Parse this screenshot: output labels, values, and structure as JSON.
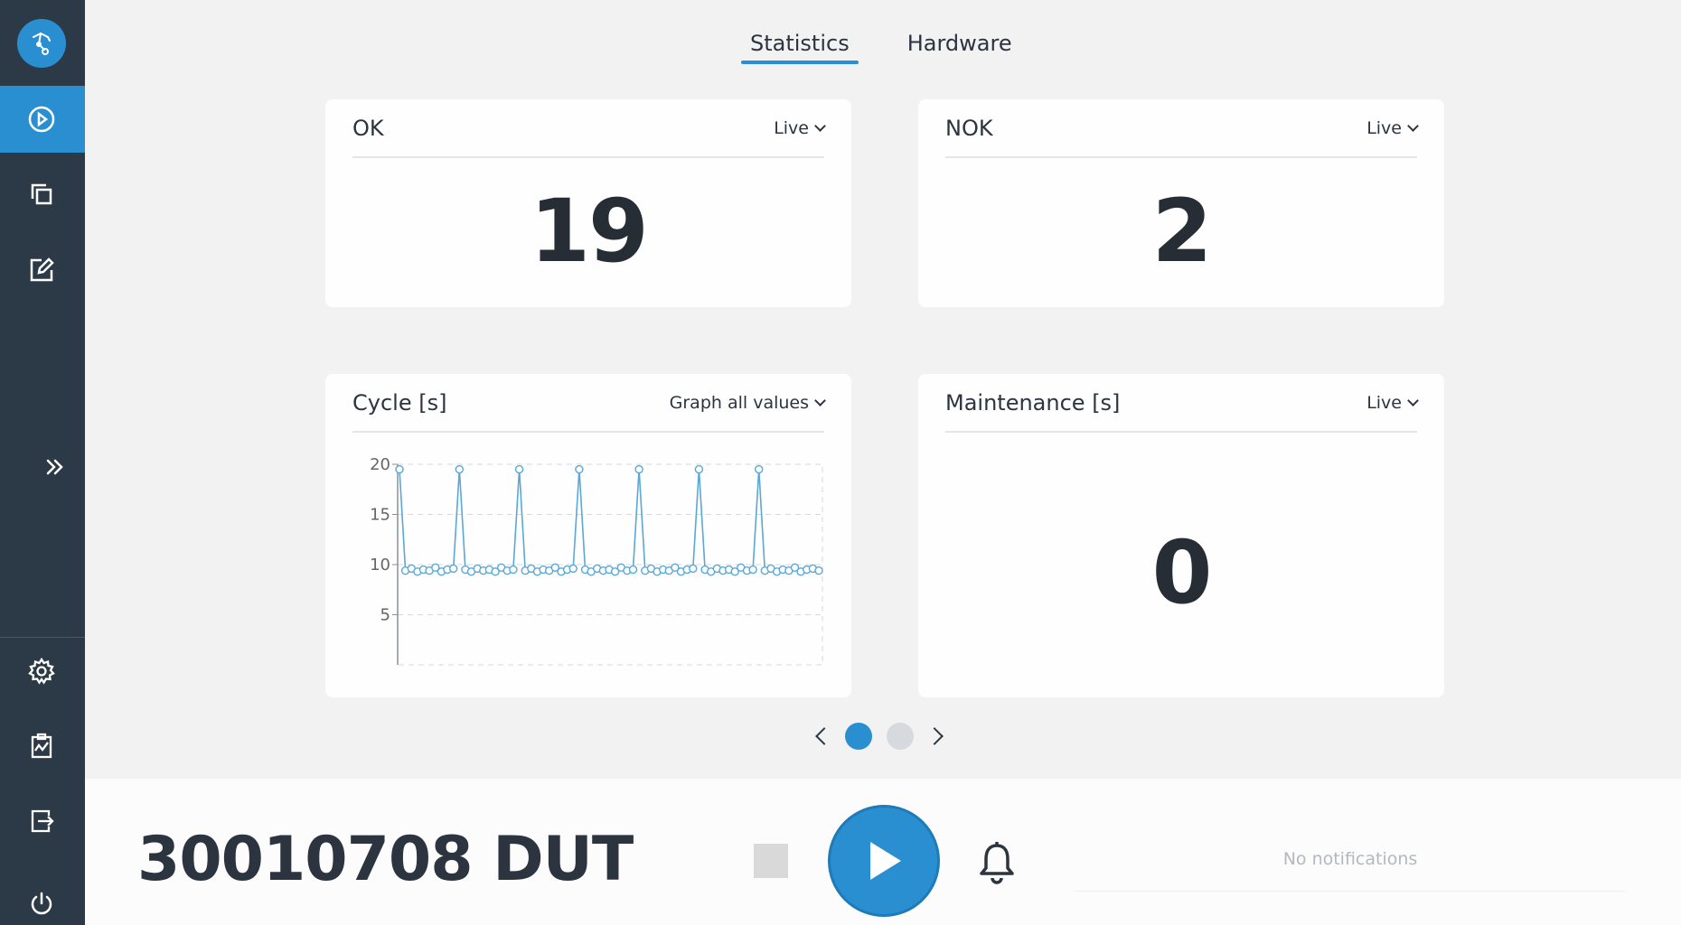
{
  "tabs": [
    {
      "label": "Statistics",
      "active": true
    },
    {
      "label": "Hardware",
      "active": false
    }
  ],
  "cards": {
    "ok": {
      "title": "OK",
      "select": "Live",
      "value": "19"
    },
    "nok": {
      "title": "NOK",
      "select": "Live",
      "value": "2"
    },
    "cycle": {
      "title": "Cycle [s]",
      "select": "Graph all values"
    },
    "maintenance": {
      "title": "Maintenance [s]",
      "select": "Live",
      "value": "0"
    }
  },
  "chart_data": {
    "type": "line",
    "title": "Cycle [s]",
    "xlabel": "",
    "ylabel": "",
    "ylim": [
      0,
      20
    ],
    "yticks": [
      5,
      10,
      15,
      20
    ],
    "grid": true,
    "color": "#5aa8d6",
    "baseline_value": 9.4,
    "spike_value": 19.5,
    "spike_count": 7,
    "series": [
      {
        "values": [
          19.5,
          9.4,
          9.6,
          9.3,
          9.5,
          9.4,
          9.7,
          9.3,
          9.5,
          9.6,
          19.5,
          9.5,
          9.3,
          9.6,
          9.4,
          9.5,
          9.3,
          9.7,
          9.4,
          9.5,
          19.5,
          9.4,
          9.6,
          9.3,
          9.5,
          9.4,
          9.7,
          9.3,
          9.5,
          9.6,
          19.5,
          9.5,
          9.3,
          9.6,
          9.4,
          9.5,
          9.3,
          9.7,
          9.4,
          9.5,
          19.5,
          9.4,
          9.6,
          9.3,
          9.5,
          9.4,
          9.7,
          9.3,
          9.5,
          9.6,
          19.5,
          9.5,
          9.3,
          9.6,
          9.4,
          9.5,
          9.3,
          9.7,
          9.4,
          9.5,
          19.5,
          9.4,
          9.6,
          9.3,
          9.5,
          9.4,
          9.7,
          9.3,
          9.5,
          9.6,
          9.4
        ]
      }
    ]
  },
  "pager": {
    "pages": 2,
    "current": 1
  },
  "bottom": {
    "dut": "30010708 DUT",
    "notifications": "No notifications"
  },
  "colors": {
    "accent": "#2a8fd1",
    "sidebar": "#2c3a48"
  }
}
